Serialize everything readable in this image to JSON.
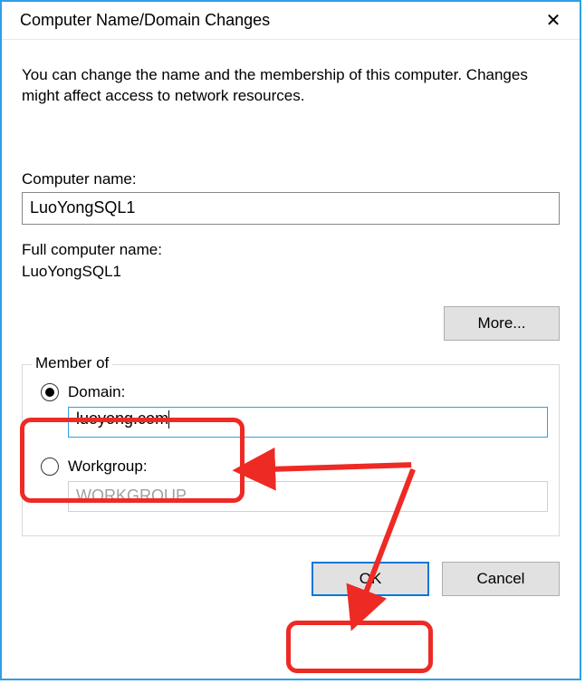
{
  "titlebar": {
    "title": "Computer Name/Domain Changes",
    "close_glyph": "✕"
  },
  "intro_text": "You can change the name and the membership of this computer. Changes might affect access to network resources.",
  "computer_name": {
    "label": "Computer name:",
    "value": "LuoYongSQL1"
  },
  "full_name": {
    "label": "Full computer name:",
    "value": "LuoYongSQL1"
  },
  "more_button": "More...",
  "member_of": {
    "legend": "Member of",
    "domain": {
      "label": "Domain:",
      "value": "luoyong.com",
      "selected": true
    },
    "workgroup": {
      "label": "Workgroup:",
      "value": "WORKGROUP",
      "selected": false
    }
  },
  "buttons": {
    "ok": "OK",
    "cancel": "Cancel"
  }
}
